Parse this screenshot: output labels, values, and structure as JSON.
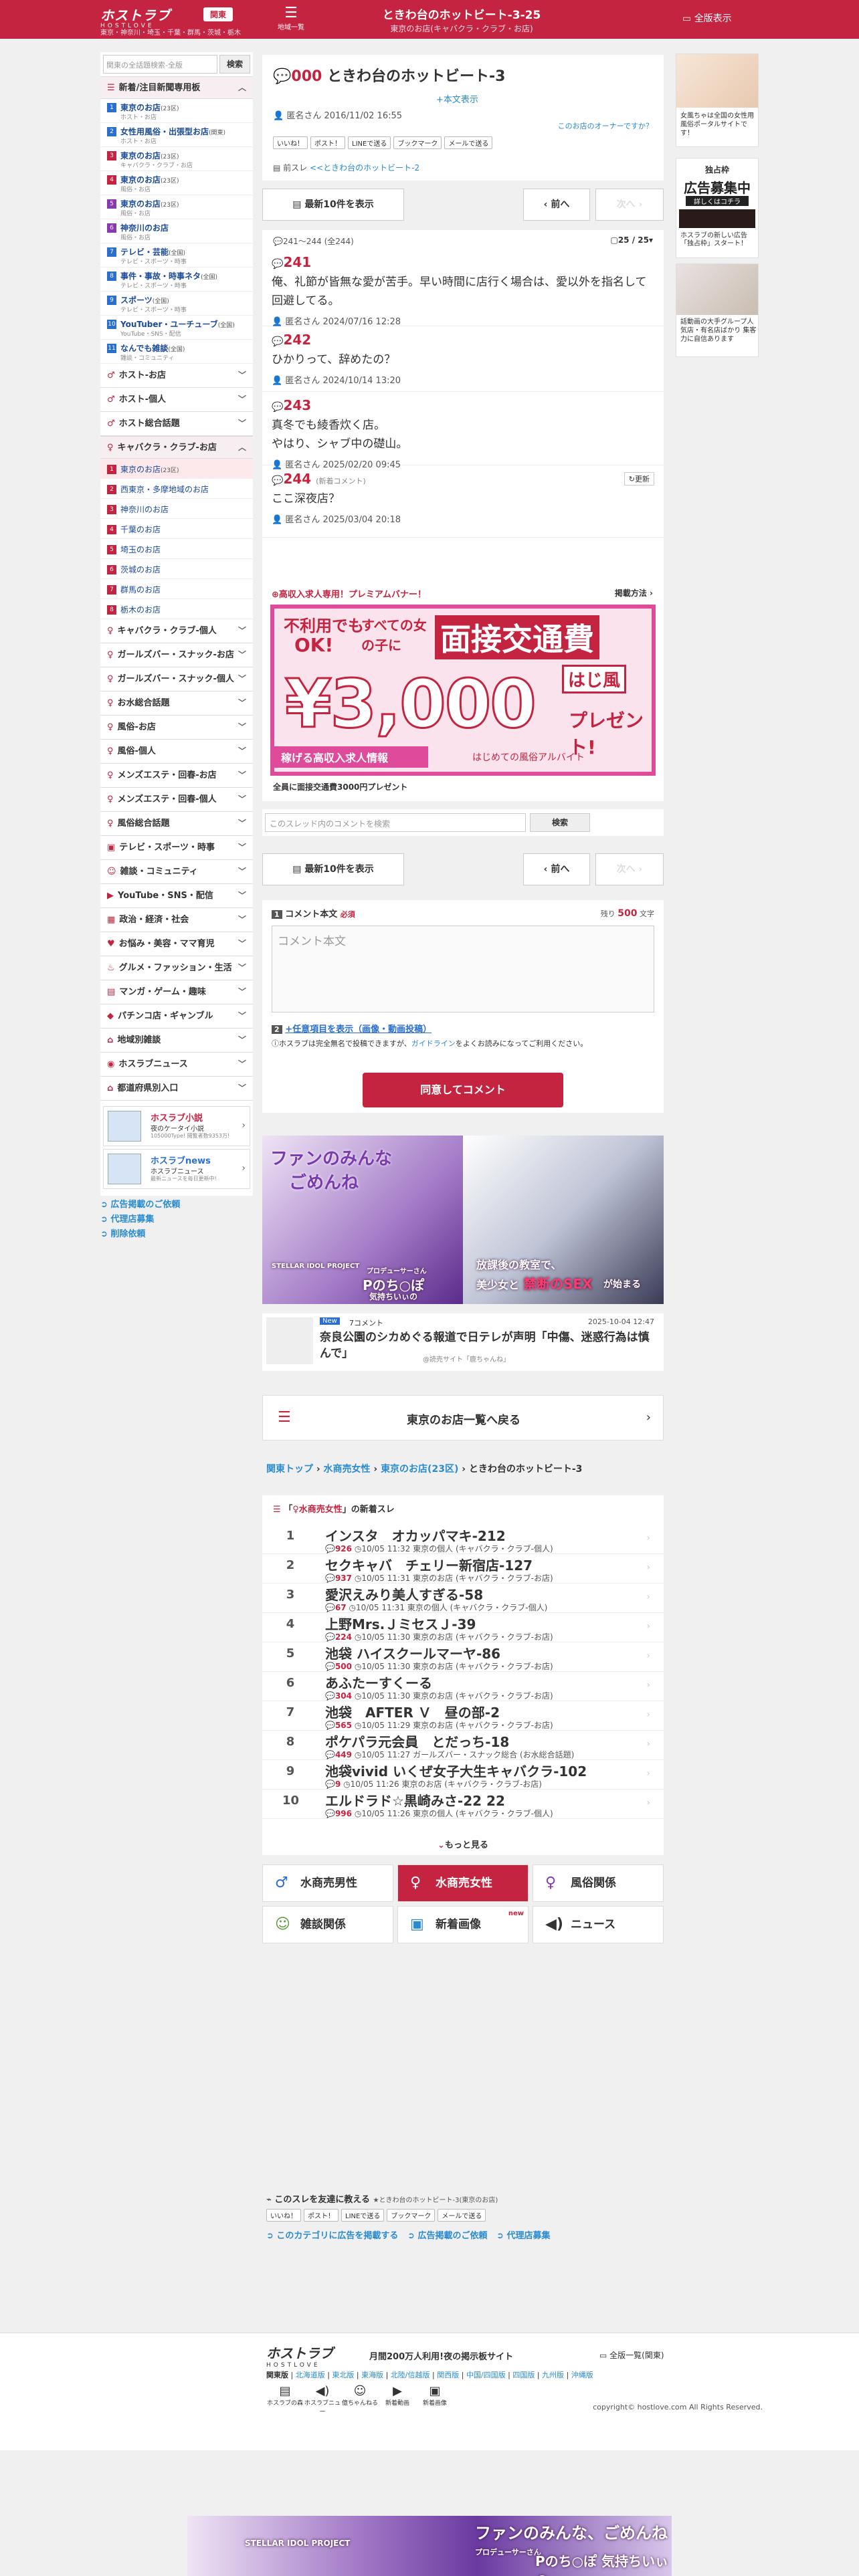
{
  "header": {
    "logo": "ホストラブ",
    "logo_sub": "HOSTLOVE",
    "region_btn": "関東",
    "regions": "東京・神奈川・埼玉・千葉・群馬・茨城・栃木",
    "menu": "地域一覧",
    "title": "ときわ台のホットビート-3-25",
    "subtitle": "東京のお店(キャバクラ・クラブ・お店)",
    "full": "全版表示"
  },
  "sidebar": {
    "search_placeholder": "関東の全話題検索-全版",
    "search_btn": "検索",
    "section1": "新着/注目新聞専用板",
    "items1": [
      {
        "n": "1",
        "label": "東京のお店",
        "cnt": "(23区)",
        "sub": "ホスト・お店",
        "color": "#2a6fd0"
      },
      {
        "n": "2",
        "label": "女性用風俗・出張型お店",
        "cnt": "(関東)",
        "sub": "ホスト・お店",
        "color": "#2a6fd0"
      },
      {
        "n": "3",
        "label": "東京のお店",
        "cnt": "(23区)",
        "sub": "キャバクラ・クラブ・お店",
        "color": "#c4243f"
      },
      {
        "n": "4",
        "label": "東京のお店",
        "cnt": "(23区)",
        "sub": "風俗・お店",
        "color": "#c4243f"
      },
      {
        "n": "5",
        "label": "東京のお店",
        "cnt": "(23区)",
        "sub": "風俗・お店",
        "color": "#8a3ab0"
      },
      {
        "n": "6",
        "label": "神奈川のお店",
        "cnt": "",
        "sub": "風俗・お店",
        "color": "#8a3ab0"
      },
      {
        "n": "7",
        "label": "テレビ・芸能",
        "cnt": "(全国)",
        "sub": "テレビ・スポーツ・時事",
        "color": "#2a6fd0"
      },
      {
        "n": "8",
        "label": "事件・事故・時事ネタ",
        "cnt": "(全国)",
        "sub": "テレビ・スポーツ・時事",
        "color": "#2a6fd0"
      },
      {
        "n": "9",
        "label": "スポーツ",
        "cnt": "(全国)",
        "sub": "テレビ・スポーツ・時事",
        "color": "#2a6fd0"
      },
      {
        "n": "10",
        "label": "YouTuber・ユーチューブ",
        "cnt": "(全国)",
        "sub": "YouTube・SNS・配信",
        "color": "#2a6fd0"
      },
      {
        "n": "11",
        "label": "なんでも雑談",
        "cnt": "(全国)",
        "sub": "雑談・コミュニティ",
        "color": "#2a6fd0"
      }
    ],
    "rows_a": [
      "ホスト-お店",
      "ホスト-個人",
      "ホスト総合話題"
    ],
    "section2": "キャバクラ・クラブ-お店",
    "items2": [
      {
        "n": "1",
        "label": "東京のお店",
        "cnt": "(23区)"
      },
      {
        "n": "2",
        "label": "西東京・多摩地域のお店",
        "cnt": ""
      },
      {
        "n": "3",
        "label": "神奈川のお店",
        "cnt": ""
      },
      {
        "n": "4",
        "label": "千葉のお店",
        "cnt": ""
      },
      {
        "n": "5",
        "label": "埼玉のお店",
        "cnt": ""
      },
      {
        "n": "6",
        "label": "茨城のお店",
        "cnt": ""
      },
      {
        "n": "7",
        "label": "群馬のお店",
        "cnt": ""
      },
      {
        "n": "8",
        "label": "栃木のお店",
        "cnt": ""
      }
    ],
    "rows_b": [
      "キャバクラ・クラブ-個人",
      "ガールズバー・スナック-お店",
      "ガールズバー・スナック-個人",
      "お水総合話題",
      "風俗-お店",
      "風俗-個人",
      "メンズエステ・回春-お店",
      "メンズエステ・回春-個人",
      "風俗総合話題",
      "テレビ・スポーツ・時事",
      "雑談・コミュニティ",
      "YouTube・SNS・配信",
      "政治・経済・社会",
      "お悩み・美容・ママ育児",
      "グルメ・ファッション・生活",
      "マンガ・ゲーム・趣味",
      "パチンコ店・ギャンブル",
      "地域別雑談",
      "ホスラブニュース",
      "都道府県別入口"
    ],
    "promo1": {
      "title": "ホスラブ小説",
      "sub": "夜のケータイ小説",
      "note": "105000Type! 閲覧者数9353万!"
    },
    "promo2": {
      "title": "ホスラブnews",
      "sub": "ホスラブニュース",
      "note": "最新ニュースを毎日更新中!"
    },
    "links": [
      "広告掲載のご依頼",
      "代理店募集",
      "削除依頼"
    ]
  },
  "thread": {
    "num": "000",
    "title": "ときわ台のホットビート-3",
    "show_body": "+本文表示",
    "author": "匿名さん",
    "date": "2016/11/02 16:55",
    "owner_q": "このお店のオーナーですか？",
    "share": [
      "いいね！",
      "ポスト！",
      "LINEで送る",
      "ブックマーク",
      "メールで送る"
    ],
    "prev_label": "前スレ",
    "prev_link": "<<ときわ台のホットビート-2"
  },
  "nav": {
    "latest": "最新10件を表示",
    "prev": "前へ",
    "next": "次へ",
    "range": "241〜244 (全244)",
    "page": "25 / 25"
  },
  "responses": [
    {
      "n": "241",
      "lines": [
        "俺、礼節が皆無な愛が苦手。早い時間に店行く場合は、愛以外を指名して回避してる。"
      ],
      "author": "匿名さん",
      "date": "2024/07/16 12:28",
      "badge": "",
      "upd": ""
    },
    {
      "n": "242",
      "lines": [
        "ひかりって、辞めたの？"
      ],
      "author": "匿名さん",
      "date": "2024/10/14 13:20",
      "badge": "",
      "upd": ""
    },
    {
      "n": "243",
      "lines": [
        "真冬でも綾香炊く店。",
        "やはり、シャブ中の礎山。"
      ],
      "author": "匿名さん",
      "date": "2025/02/20 09:45",
      "badge": "",
      "upd": ""
    },
    {
      "n": "244",
      "lines": [
        "ここ深夜店？"
      ],
      "author": "匿名さん",
      "date": "2025/03/04 20:18",
      "badge": "(新着コメント)",
      "upd": "更新"
    }
  ],
  "banner": {
    "head": "高収入求人専用！プレミアムバナー！",
    "more": "掲載方法",
    "l1": "不利用でも",
    "l2": "OK!",
    "l3": "すべての女の子に",
    "l4": "面接交通費",
    "l5": "¥3,000",
    "l6": "プレゼント!",
    "l7": "稼げる高収入求人情報",
    "l8": "はじめての風俗アルバイト",
    "brand": "はじ風",
    "caption": "全員に面接交通費3000円プレゼント"
  },
  "thread_search": {
    "placeholder": "このスレッド内のコメントを検索",
    "btn": "検索"
  },
  "comment": {
    "label": "コメント本文",
    "req": "必須",
    "remain_label": "残り",
    "remain": "500",
    "unit": "文字",
    "placeholder": "コメント本文",
    "opt": "+任意項目を表示（画像・動画投稿）",
    "note": "ホスラブは完全無名で投稿できますが、",
    "guide": "ガイドライン",
    "note2": "をよくお読みになってご利用ください。",
    "submit": "同意してコメント"
  },
  "ad1": {
    "left_title": "ファンのみんな",
    "left_title2": "ごめんね",
    "right_title": "放課後の教室で、",
    "right_sub": "美少女と",
    "right_sub2": "禁断のSEX",
    "right_sub3": "が始まる",
    "left_note": "プロデューサーさん",
    "left_note2": "Pのち○ぽ",
    "left_note3": "気持ちいぃの",
    "left_brand": "STELLAR IDOL PROJECT"
  },
  "news": {
    "tag": "New",
    "comments": "7コメント",
    "date": "2025-10-04 12:47",
    "title": "奈良公園のシカめぐる報道で日テレが声明「中傷、迷惑行為は慎んで」",
    "source": "@読売サイト「鹿ちゃんね」"
  },
  "back": "東京のお店一覧へ戻る",
  "breadcrumb": [
    "関東トップ",
    "水商売女性",
    "東京のお店(23区)",
    "ときわ台のホットビート-3"
  ],
  "ranking": {
    "head_pre": "「",
    "head_cat": "水商売女性",
    "head_post": "」の新着スレ",
    "more": "もっと見る",
    "items": [
      {
        "rank": "1",
        "title": "インスタ　オカッパマキ-212",
        "cnt": "926",
        "time": "10/05 11:32",
        "cat": "東京の個人",
        "sub": "(キャバクラ・クラブ-個人)"
      },
      {
        "rank": "2",
        "title": "セクキャバ　チェリー新宿店-127",
        "cnt": "937",
        "time": "10/05 11:31",
        "cat": "東京のお店",
        "sub": "(キャバクラ・クラブ-お店)"
      },
      {
        "rank": "3",
        "title": "愛沢えみり美人すぎる-58",
        "cnt": "67",
        "time": "10/05 11:31",
        "cat": "東京の個人",
        "sub": "(キャバクラ・クラブ-個人)"
      },
      {
        "rank": "4",
        "title": "上野Mrs.ＪミセスＪ-39",
        "cnt": "224",
        "time": "10/05 11:30",
        "cat": "東京のお店",
        "sub": "(キャバクラ・クラブ-お店)"
      },
      {
        "rank": "5",
        "title": "池袋 ハイスクールマーヤ-86",
        "cnt": "500",
        "time": "10/05 11:30",
        "cat": "東京のお店",
        "sub": "(キャバクラ・クラブ-お店)"
      },
      {
        "rank": "6",
        "title": "あふたーすくーる",
        "cnt": "304",
        "time": "10/05 11:30",
        "cat": "東京のお店",
        "sub": "(キャバクラ・クラブ-お店)"
      },
      {
        "rank": "7",
        "title": "池袋　AFTER Ｖ　昼の部-2",
        "cnt": "565",
        "time": "10/05 11:29",
        "cat": "東京のお店",
        "sub": "(キャバクラ・クラブ-お店)"
      },
      {
        "rank": "8",
        "title": "ポケパラ元会員　とだっち-18",
        "cnt": "449",
        "time": "10/05 11:27",
        "cat": "ガールズバー・スナック総合",
        "sub": "(お水総合話題)"
      },
      {
        "rank": "9",
        "title": "池袋vivid いくぜ女子大生キャバクラ-102",
        "cnt": "9",
        "time": "10/05 11:26",
        "cat": "東京のお店",
        "sub": "(キャバクラ・クラブ-お店)"
      },
      {
        "rank": "10",
        "title": "エルドラド☆黒崎みさ-22 22",
        "cnt": "996",
        "time": "10/05 11:26",
        "cat": "東京の個人",
        "sub": "(キャバクラ・クラブ-個人)"
      }
    ]
  },
  "genres": [
    {
      "label": "水商売男性",
      "icon": "♂",
      "color": "#2a6fd0",
      "active": false
    },
    {
      "label": "水商売女性",
      "icon": "♀",
      "color": "#c4243f",
      "active": true
    },
    {
      "label": "風俗関係",
      "icon": "♀",
      "color": "#8a3ab0",
      "active": false
    },
    {
      "label": "雑談関係",
      "icon": "☺",
      "color": "#5a9a3a",
      "active": false
    },
    {
      "label": "新着画像",
      "icon": "▣",
      "color": "#2a8bd0",
      "active": false,
      "badge": "new"
    },
    {
      "label": "ニュース",
      "icon": "◀)",
      "color": "#333",
      "active": false
    }
  ],
  "share_bottom": {
    "title": "このスレを友達に教える",
    "sub": "★ときわ台のホットビート-3(東京のお店)",
    "buttons": [
      "いいね！",
      "ポスト！",
      "LINEで送る",
      "ブックマーク",
      "メールで送る"
    ],
    "links": [
      "このカテゴリに広告を掲載する",
      "広告掲載のご依頼",
      "代理店募集"
    ]
  },
  "right": {
    "a1": "女風ちゃは全国の女性用風俗ポータルサイトです！",
    "a2t1": "独占枠",
    "a2t2": "広告募集中",
    "a2t3": "詳しくはコチラ",
    "a2t4": "ホスラブの新しい広告「独占枠」スタート！",
    "a3": "話動画の大手グループ人気店・有名店ばかり 集客力に自信あります"
  },
  "footer": {
    "logo": "ホストラブ",
    "logo_sub": "HOSTLOVE",
    "slogan": "月間200万人利用!夜の掲示板サイト",
    "full": "全版一覧(関東)",
    "regions_label": "関東版",
    "regions": [
      "北海道版",
      "東北版",
      "東海版",
      "北陸/信越版",
      "関西版",
      "中国/四国版",
      "四国版",
      "九州版",
      "沖縄版"
    ],
    "icons": [
      "ホスラブの森",
      "ホスラブニュー",
      "億ちゃんねる",
      "新着動画",
      "新着画像"
    ],
    "copyright": "copyright© hostlove.com All Rights Reserved."
  },
  "bottom_ad": {
    "l1": "ファンのみんな、ごめんね",
    "l2": "プロデューサーさん",
    "l3": "Pのち○ぽ 気持ちいぃの",
    "brand": "STELLAR IDOL PROJECT"
  }
}
